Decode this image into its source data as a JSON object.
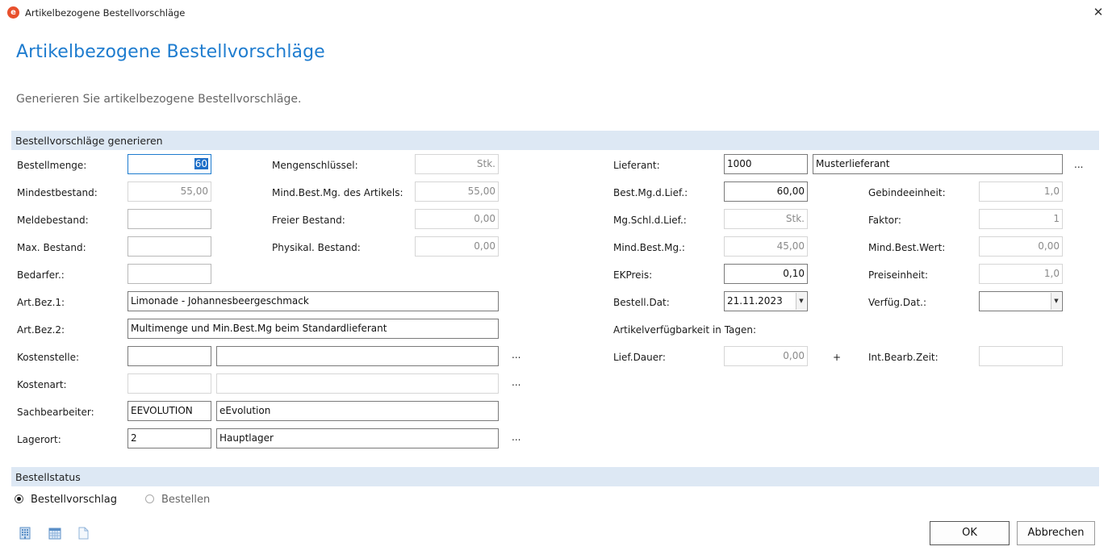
{
  "window": {
    "title": "Artikelbezogene Bestellvorschläge",
    "close_glyph": "✕",
    "app_icon": "eevolution-logo-icon"
  },
  "header": {
    "title": "Artikelbezogene Bestellvorschläge",
    "subtitle": "Generieren Sie artikelbezogene Bestellvorschläge."
  },
  "section_generate": {
    "title": "Bestellvorschläge generieren",
    "bestellmenge": {
      "label": "Bestellmenge:",
      "value": "60"
    },
    "mindestbestand": {
      "label": "Mindestbestand:",
      "value": "55,00"
    },
    "meldebestand": {
      "label": "Meldebestand:",
      "value": ""
    },
    "max_bestand": {
      "label": "Max. Bestand:",
      "value": ""
    },
    "bedarfer": {
      "label": "Bedarfer.:",
      "value": ""
    },
    "art_bez1": {
      "label": "Art.Bez.1:",
      "value": "Limonade - Johannesbeergeschmack"
    },
    "art_bez2": {
      "label": "Art.Bez.2:",
      "value": "Multimenge und Min.Best.Mg beim Standardlieferant"
    },
    "kostenstelle": {
      "label": "Kostenstelle:",
      "code": "",
      "name": ""
    },
    "kostenart": {
      "label": "Kostenart:",
      "code": "",
      "name": ""
    },
    "sachbearbeiter": {
      "label": "Sachbearbeiter:",
      "code": "EEVOLUTION",
      "name": "eEvolution"
    },
    "lagerort": {
      "label": "Lagerort:",
      "code": "2",
      "name": "Hauptlager"
    },
    "mengenschluessel": {
      "label": "Mengenschlüssel:",
      "value": "Stk."
    },
    "mind_best_mg_artikel": {
      "label": "Mind.Best.Mg. des Artikels:",
      "value": "55,00"
    },
    "freier_bestand": {
      "label": "Freier Bestand:",
      "value": "0,00"
    },
    "physikal_bestand": {
      "label": "Physikal. Bestand:",
      "value": "0,00"
    },
    "lieferant": {
      "label": "Lieferant:",
      "code": "1000",
      "name": "Musterlieferant"
    },
    "best_mg_d_lief": {
      "label": "Best.Mg.d.Lief.:",
      "value": "60,00"
    },
    "mg_schl_d_lief": {
      "label": "Mg.Schl.d.Lief.:",
      "value": "Stk."
    },
    "mind_best_mg": {
      "label": "Mind.Best.Mg.:",
      "value": "45,00"
    },
    "ekpreis": {
      "label": "EKPreis:",
      "value": "0,10"
    },
    "bestell_dat": {
      "label": "Bestell.Dat:",
      "value": "21.11.2023"
    },
    "artikelverfuegbarkeit": {
      "label": "Artikelverfügbarkeit in Tagen:"
    },
    "lief_dauer": {
      "label": "Lief.Dauer:",
      "value": "0,00"
    },
    "plus": "+",
    "gebindeeinheit": {
      "label": "Gebindeeinheit:",
      "value": "1,0"
    },
    "faktor": {
      "label": "Faktor:",
      "value": "1"
    },
    "mind_best_wert": {
      "label": "Mind.Best.Wert:",
      "value": "0,00"
    },
    "preiseinheit": {
      "label": "Preiseinheit:",
      "value": "1,0"
    },
    "verfueg_dat": {
      "label": "Verfüg.Dat.:",
      "value": ""
    },
    "int_bearb_zeit": {
      "label": "Int.Bearb.Zeit:",
      "value": ""
    },
    "browse_glyph": "...",
    "dropdown_glyph": "▼"
  },
  "section_status": {
    "title": "Bestellstatus",
    "options": [
      {
        "label": "Bestellvorschlag",
        "selected": true
      },
      {
        "label": "Bestellen",
        "selected": false
      }
    ]
  },
  "footer": {
    "icons": [
      "building-icon",
      "calendar-icon",
      "document-icon"
    ],
    "ok_label": "OK",
    "cancel_label": "Abbrechen"
  },
  "colors": {
    "accent": "#1e7ccf",
    "section_bg": "#dde8f4",
    "selection": "#1e6fc8"
  }
}
